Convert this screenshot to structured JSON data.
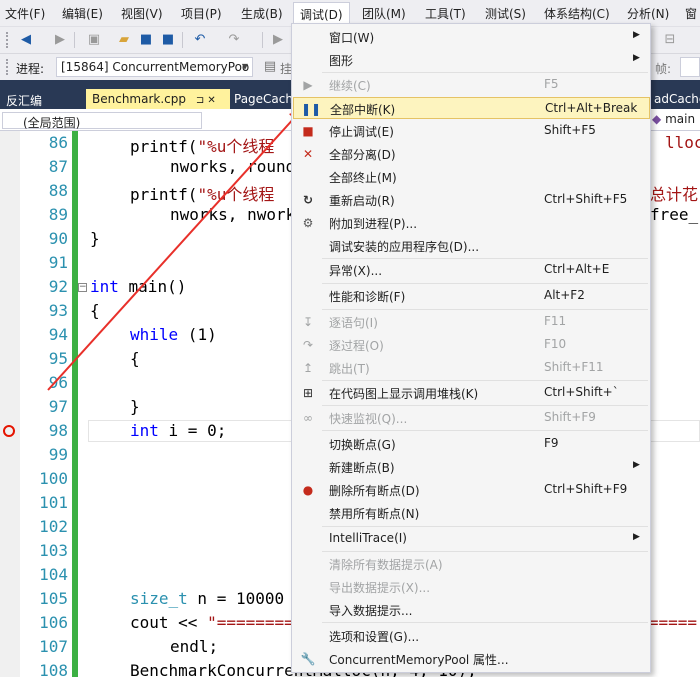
{
  "menubar": {
    "items": [
      "文件(F)",
      "编辑(E)",
      "视图(V)",
      "项目(P)",
      "生成(B)",
      "调试(D)",
      "团队(M)",
      "工具(T)",
      "测试(S)",
      "体系结构(C)",
      "分析(N)",
      "窗"
    ]
  },
  "toolbar": {
    "process_label": "进程:",
    "process_value": "[15864] ConcurrentMemoryPoo",
    "right_label": "帧:",
    "right_text": "挂"
  },
  "tabs": {
    "left": "反汇编",
    "active": "Benchmark.cpp",
    "pin": "⊐ ✕",
    "next": "PageCache",
    "right": "adCache."
  },
  "navbar": {
    "scope": "(全局范围)",
    "right": "main"
  },
  "editor": {
    "line_numbers": [
      "86",
      "87",
      "88",
      "89",
      "90",
      "91",
      "92",
      "93",
      "94",
      "95",
      "96",
      "97",
      "98",
      "99",
      "100",
      "101",
      "102",
      "103",
      "104",
      "105",
      "106",
      "107",
      "108"
    ],
    "lines": {
      "l86_fn": "printf(",
      "l86_str": "\"%u个线程",
      "l86_tail": "lloc ",
      "l87": "nworks, round",
      "l88_fn": "printf(",
      "l88_str": "\"%u个线程",
      "l88_tail": "总计花",
      "l89": "nworks, nwork",
      "l89_tail": "free_",
      "l90": "}",
      "l92_kw": "int",
      "l92_rest": " main()",
      "l93": "{",
      "l94_kw": "while",
      "l94_rest": " (1)",
      "l95": "{",
      "l97": "}",
      "l98_kw": "int",
      "l98_rest": " i = 0;",
      "l105_ty": "size_t",
      "l105_rest": " n = 10000",
      "l106_a": "cout << ",
      "l106_str": "\"=========",
      "l106_tail": "========",
      "l107": "endl;",
      "l108": "BenchmarkConcurrentMalloc(n, 4, 10);"
    }
  },
  "debug_menu": {
    "items": [
      {
        "label": "窗口(W)",
        "shortcut": "",
        "submenu": true,
        "icon": "",
        "disabled": false
      },
      {
        "label": "图形",
        "shortcut": "",
        "submenu": true,
        "icon": "",
        "disabled": false
      },
      {
        "label": "继续(C)",
        "shortcut": "F5",
        "submenu": false,
        "icon": "play-icon",
        "disabled": true
      },
      {
        "label": "全部中断(K)",
        "shortcut": "Ctrl+Alt+Break",
        "submenu": false,
        "icon": "pause-icon",
        "disabled": false
      },
      {
        "label": "停止调试(E)",
        "shortcut": "Shift+F5",
        "submenu": false,
        "icon": "stop-icon",
        "disabled": false
      },
      {
        "label": "全部分离(D)",
        "shortcut": "",
        "submenu": false,
        "icon": "detach-icon",
        "disabled": false
      },
      {
        "label": "全部终止(M)",
        "shortcut": "",
        "submenu": false,
        "icon": "",
        "disabled": false
      },
      {
        "label": "重新启动(R)",
        "shortcut": "Ctrl+Shift+F5",
        "submenu": false,
        "icon": "restart-icon",
        "disabled": false
      },
      {
        "label": "附加到进程(P)...",
        "shortcut": "",
        "submenu": false,
        "icon": "attach-icon",
        "disabled": false
      },
      {
        "label": "调试安装的应用程序包(D)...",
        "shortcut": "",
        "submenu": false,
        "icon": "",
        "disabled": false
      },
      {
        "label": "异常(X)...",
        "shortcut": "Ctrl+Alt+E",
        "submenu": false,
        "icon": "",
        "disabled": false
      },
      {
        "label": "性能和诊断(F)",
        "shortcut": "Alt+F2",
        "submenu": false,
        "icon": "",
        "disabled": false
      },
      {
        "label": "逐语句(I)",
        "shortcut": "F11",
        "submenu": false,
        "icon": "step-into-icon",
        "disabled": true
      },
      {
        "label": "逐过程(O)",
        "shortcut": "F10",
        "submenu": false,
        "icon": "step-over-icon",
        "disabled": true
      },
      {
        "label": "跳出(T)",
        "shortcut": "Shift+F11",
        "submenu": false,
        "icon": "step-out-icon",
        "disabled": true
      },
      {
        "label": "在代码图上显示调用堆栈(K)",
        "shortcut": "Ctrl+Shift+`",
        "submenu": false,
        "icon": "code-map-icon",
        "disabled": false
      },
      {
        "label": "快速监视(Q)...",
        "shortcut": "Shift+F9",
        "submenu": false,
        "icon": "quickwatch-icon",
        "disabled": true
      },
      {
        "label": "切换断点(G)",
        "shortcut": "F9",
        "submenu": false,
        "icon": "",
        "disabled": false
      },
      {
        "label": "新建断点(B)",
        "shortcut": "",
        "submenu": true,
        "icon": "",
        "disabled": false
      },
      {
        "label": "删除所有断点(D)",
        "shortcut": "Ctrl+Shift+F9",
        "submenu": false,
        "icon": "delete-breakpoints-icon",
        "disabled": false
      },
      {
        "label": "禁用所有断点(N)",
        "shortcut": "",
        "submenu": false,
        "icon": "",
        "disabled": false
      },
      {
        "label": "IntelliTrace(I)",
        "shortcut": "",
        "submenu": true,
        "icon": "",
        "disabled": false
      },
      {
        "label": "清除所有数据提示(A)",
        "shortcut": "",
        "submenu": false,
        "icon": "",
        "disabled": true
      },
      {
        "label": "导出数据提示(X)...",
        "shortcut": "",
        "submenu": false,
        "icon": "",
        "disabled": true
      },
      {
        "label": "导入数据提示...",
        "shortcut": "",
        "submenu": false,
        "icon": "",
        "disabled": false
      },
      {
        "label": "选项和设置(G)...",
        "shortcut": "",
        "submenu": false,
        "icon": "",
        "disabled": false
      },
      {
        "label": "ConcurrentMemoryPool 属性...",
        "shortcut": "",
        "submenu": false,
        "icon": "wrench-icon",
        "disabled": false
      }
    ]
  },
  "colors": {
    "highlight_bg": "#fdf4bf",
    "annotation_arrow": "#e8302a",
    "line_number": "#2b91af",
    "keyword": "#0000ff",
    "string": "#a31515",
    "change_bar": "#3cb043"
  }
}
